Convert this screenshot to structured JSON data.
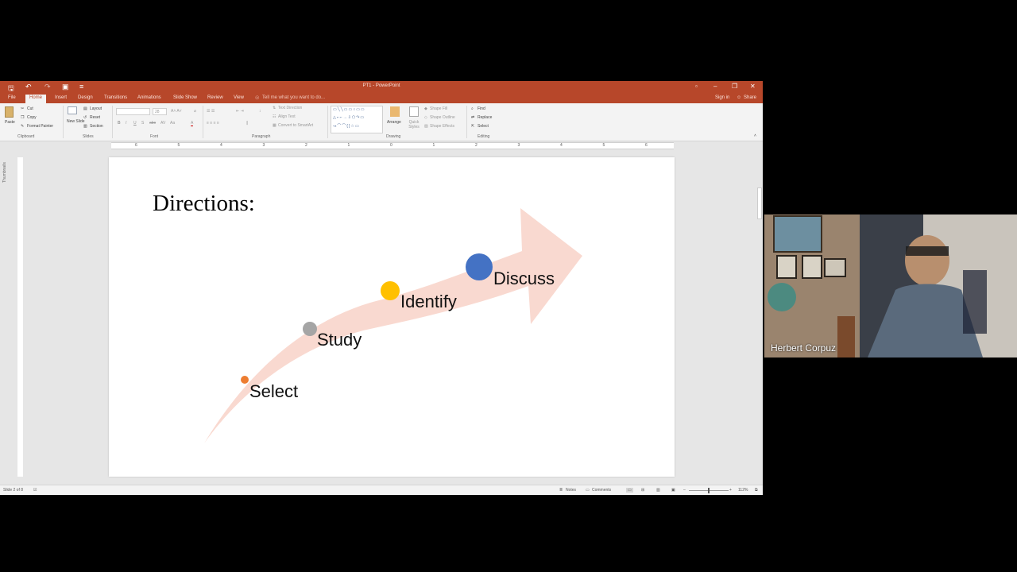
{
  "window": {
    "title": "PT1 - PowerPoint",
    "sign_in": "Sign in",
    "share": "Share"
  },
  "ribbon": {
    "tabs": [
      "File",
      "Home",
      "Insert",
      "Design",
      "Transitions",
      "Animations",
      "Slide Show",
      "Review",
      "View"
    ],
    "tell_me": "Tell me what you want to do...",
    "clipboard": {
      "paste": "Paste",
      "cut": "Cut",
      "copy": "Copy",
      "format_painter": "Format Painter",
      "label": "Clipboard"
    },
    "slides": {
      "new_slide": "New Slide",
      "layout": "Layout",
      "reset": "Reset",
      "section": "Section",
      "label": "Slides"
    },
    "font": {
      "label": "Font",
      "size": "28"
    },
    "paragraph": {
      "text_direction": "Text Direction",
      "align_text": "Align Text",
      "convert": "Convert to SmartArt",
      "label": "Paragraph"
    },
    "drawing": {
      "arrange": "Arrange",
      "quick_styles": "Quick Styles",
      "shape_fill": "Shape Fill",
      "shape_outline": "Shape Outline",
      "shape_effects": "Shape Effects",
      "label": "Drawing"
    },
    "editing": {
      "find": "Find",
      "replace": "Replace",
      "select": "Select",
      "label": "Editing"
    }
  },
  "ruler_ticks": [
    "6",
    "5",
    "4",
    "3",
    "2",
    "1",
    "0",
    "1",
    "2",
    "3",
    "4",
    "5",
    "6"
  ],
  "left_panel": {
    "label": "Thumbnails"
  },
  "slide": {
    "title": "Directions:",
    "steps": [
      {
        "label": "Select",
        "color": "#ed7d31"
      },
      {
        "label": "Study",
        "color": "#a5a5a5"
      },
      {
        "label": "Identify",
        "color": "#ffc000"
      },
      {
        "label": "Discuss",
        "color": "#4472c4"
      }
    ],
    "arrow_color": "#f9d9d0"
  },
  "status": {
    "slide_count": "Slide 2 of 8",
    "notes": "Notes",
    "comments": "Comments",
    "zoom": "112%"
  },
  "video": {
    "speaker": "Herbert Corpuz"
  }
}
